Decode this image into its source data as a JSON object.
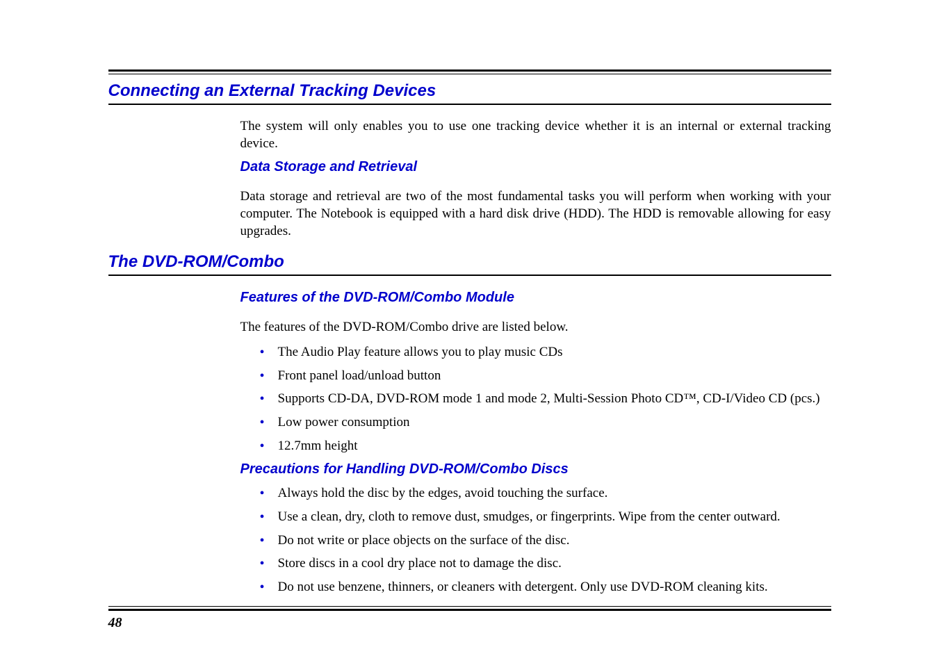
{
  "sections": {
    "s1": {
      "title": "Connecting an External Tracking Devices",
      "para1": "The system will only enables you to use one tracking device whether it is an internal or external tracking device.",
      "sub1": {
        "title": "Data Storage and Retrieval",
        "para": "Data storage and retrieval are two of the most fundamental tasks you will perform when working with your computer.  The Notebook is equipped with a hard disk drive (HDD).  The HDD is removable allowing for easy upgrades."
      }
    },
    "s2": {
      "title": "The DVD-ROM/Combo",
      "sub1": {
        "title": "Features of the DVD-ROM/Combo Module",
        "para": "The features of the DVD-ROM/Combo drive are listed below.",
        "items": [
          "The Audio Play feature allows you to play music CDs",
          "Front panel load/unload button",
          "Supports CD-DA, DVD-ROM mode 1 and mode 2, Multi-Session Photo CD™, CD-I/Video CD (pcs.)",
          "Low power consumption",
          "12.7mm height"
        ]
      },
      "sub2": {
        "title": "Precautions for Handling DVD-ROM/Combo Discs",
        "items": [
          "Always hold the disc by the edges, avoid touching the surface.",
          "Use a clean, dry, cloth to remove dust, smudges, or fingerprints.  Wipe from the center outward.",
          "Do not write or place objects on the surface of the disc.",
          "Store discs in a cool dry place not to damage the disc.",
          "Do not use benzene, thinners, or cleaners with detergent.  Only use DVD-ROM cleaning kits."
        ]
      }
    }
  },
  "page_number": "48"
}
